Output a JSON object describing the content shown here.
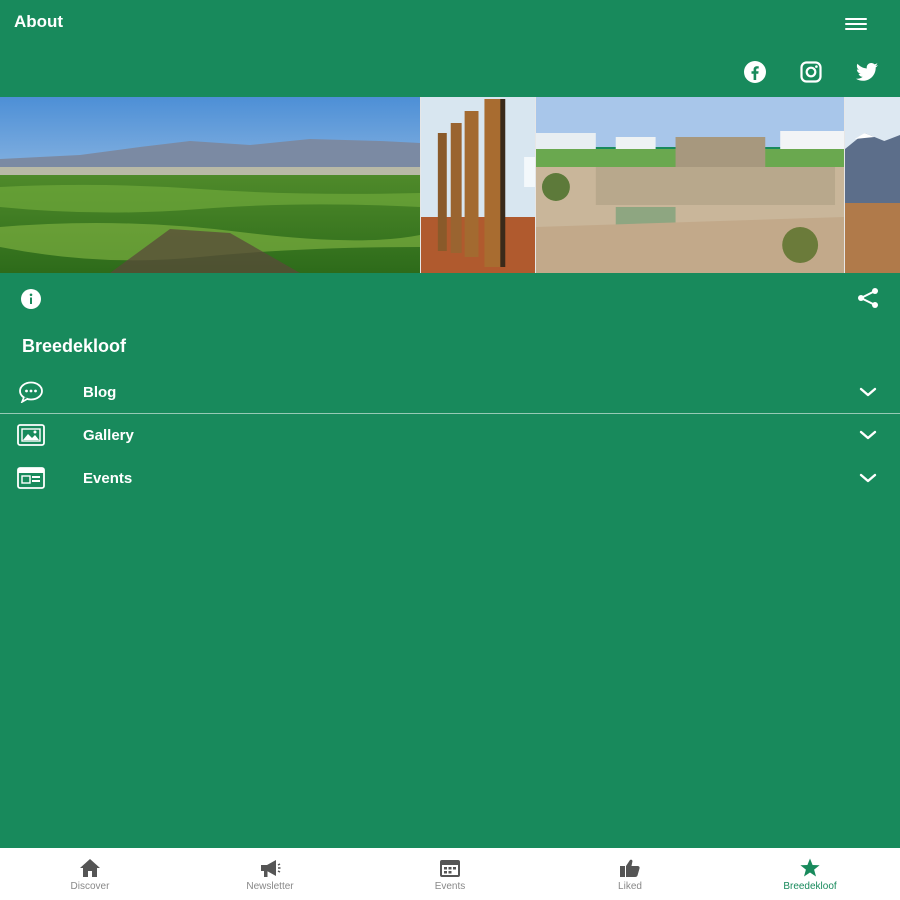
{
  "header": {
    "title": "About"
  },
  "social": [
    {
      "icon": "facebook-icon"
    },
    {
      "icon": "instagram-icon"
    },
    {
      "icon": "twitter-icon"
    }
  ],
  "section": {
    "title": "Breedekloof"
  },
  "accordion": [
    {
      "label": "Blog",
      "icon": "chat-bubble-icon"
    },
    {
      "label": "Gallery",
      "icon": "image-gallery-icon"
    },
    {
      "label": "Events",
      "icon": "calendar-card-icon"
    }
  ],
  "bottom_nav": [
    {
      "label": "Discover",
      "icon": "home-icon"
    },
    {
      "label": "Newsletter",
      "icon": "megaphone-icon"
    },
    {
      "label": "Events",
      "icon": "calendar-icon"
    },
    {
      "label": "Liked",
      "icon": "thumbs-up-icon"
    },
    {
      "label": "Breedekloof",
      "icon": "star-icon",
      "active": true
    }
  ],
  "colors": {
    "primary": "#188a5c",
    "nav_background": "#ffffff",
    "nav_text": "#888888"
  }
}
